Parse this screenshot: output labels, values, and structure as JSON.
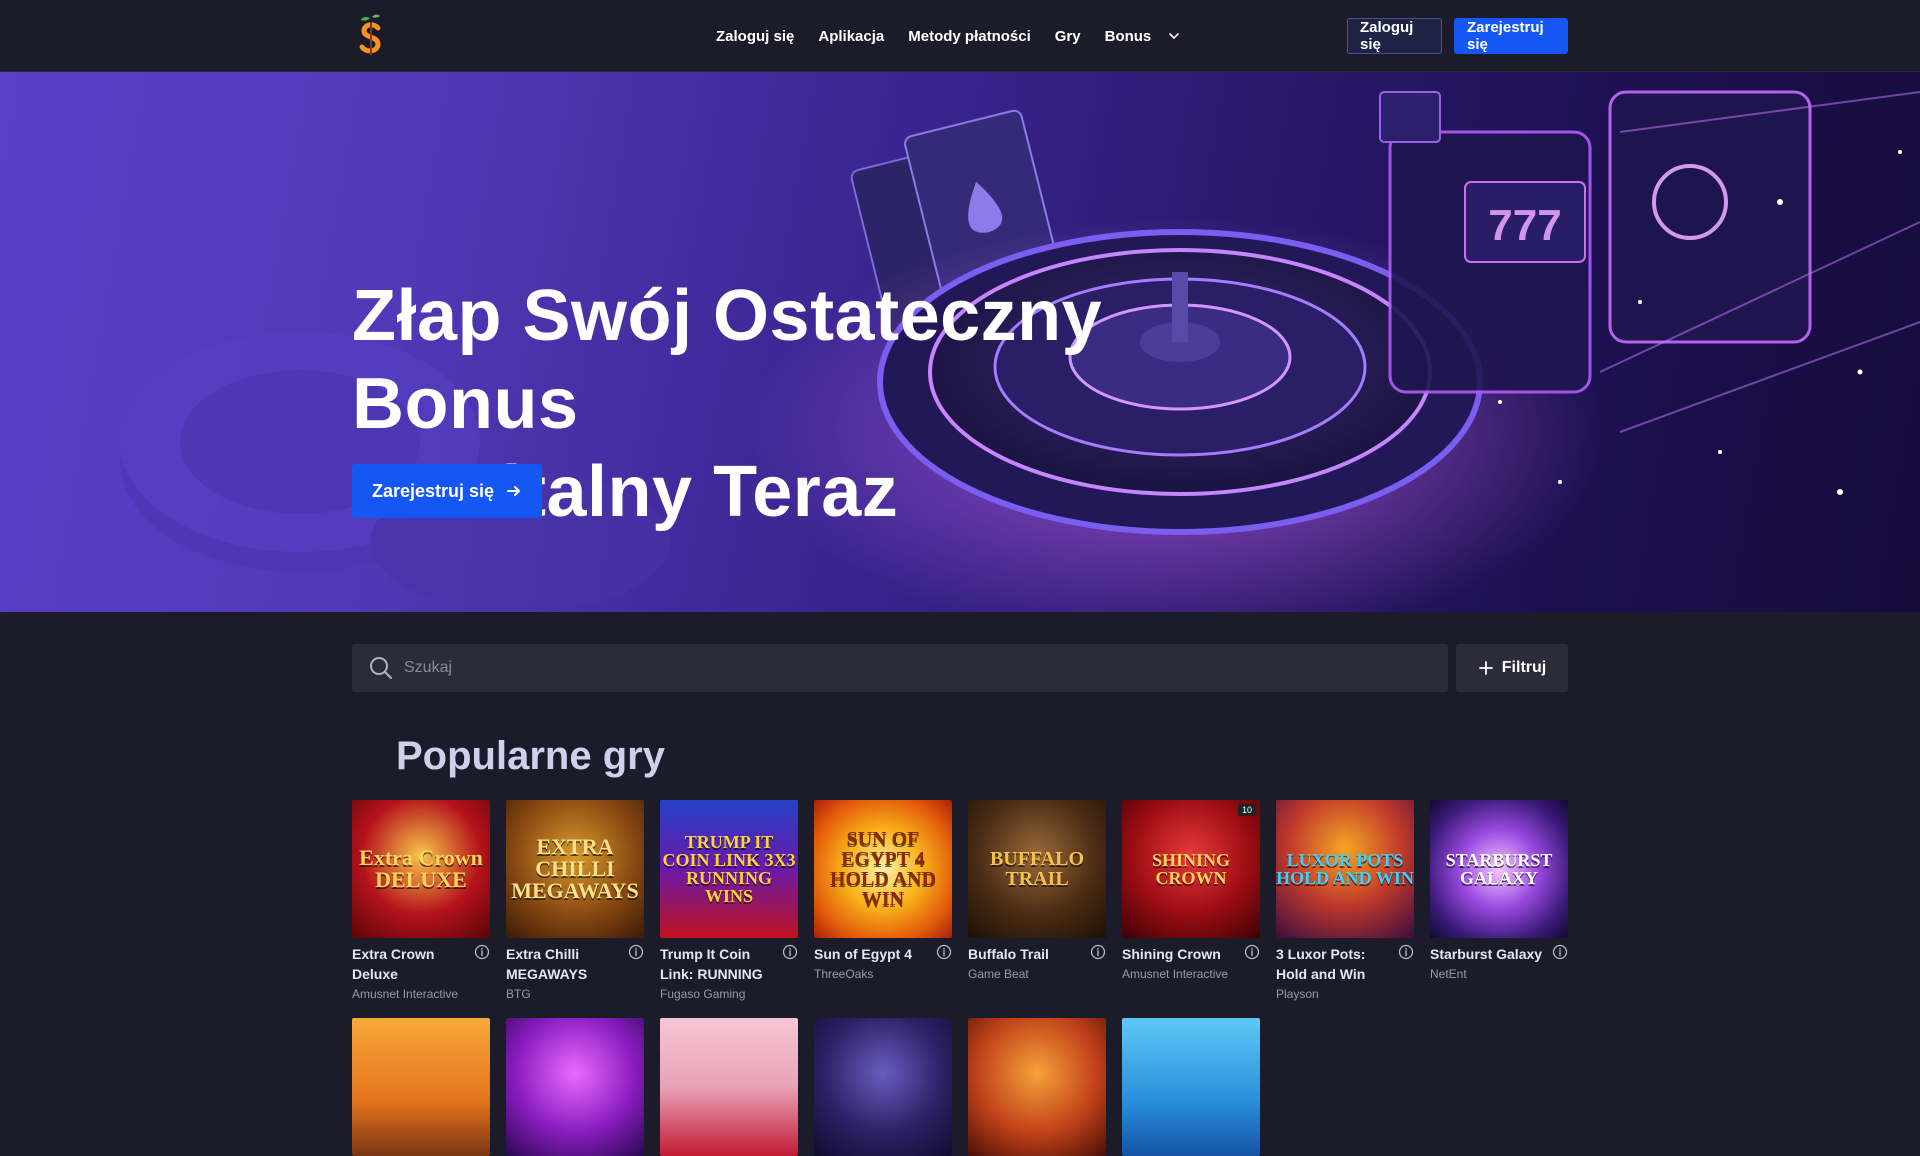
{
  "header": {
    "nav": [
      {
        "label": "Zaloguj się"
      },
      {
        "label": "Aplikacja"
      },
      {
        "label": "Metody płatności"
      },
      {
        "label": "Gry"
      },
      {
        "label": "Bonus"
      }
    ],
    "login_label": "Zaloguj się",
    "register_label": "Zarejestruj się"
  },
  "hero": {
    "title_line1": "Złap Swój Ostateczny Bonus",
    "title_line2": "Powitalny Teraz",
    "cta_label": "Zarejestruj się"
  },
  "search": {
    "placeholder": "Szukaj",
    "filter_label": "Filtruj"
  },
  "popular": {
    "title": "Popularne gry",
    "games": [
      {
        "name": "Extra Crown Deluxe",
        "provider": "Amusnet Interactive",
        "art": "Extra Crown DELUXE"
      },
      {
        "name": "Extra Chilli MEGAWAYS",
        "provider": "BTG",
        "art": "EXTRA CHILLI MEGAWAYS"
      },
      {
        "name": "Trump It Coin Link: RUNNING",
        "provider": "Fugaso Gaming",
        "art": "TRUMP IT COIN LINK 3X3 RUNNING WINS"
      },
      {
        "name": "Sun of Egypt 4",
        "provider": "ThreeOaks",
        "art": "SUN OF EGYPT 4 HOLD AND WIN"
      },
      {
        "name": "Buffalo Trail",
        "provider": "Game Beat",
        "art": "BUFFALO TRAIL"
      },
      {
        "name": "Shining Crown",
        "provider": "Amusnet Interactive",
        "art": "SHINING CROWN",
        "badge": "10"
      },
      {
        "name": "3 Luxor Pots: Hold and Win",
        "provider": "Playson",
        "art": "LUXOR POTS HOLD AND WIN"
      },
      {
        "name": "Starburst Galaxy",
        "provider": "NetEnt",
        "art": "STARBURST GALAXY"
      }
    ]
  },
  "colors": {
    "background": "#1b1b2a",
    "accent_blue": "#1457f5",
    "section_title": "#cfd0ec"
  },
  "icons": {
    "logo": "pear-s-logo-icon",
    "search": "search-icon",
    "filter": "plus-icon",
    "cta_arrow": "arrow-right-icon",
    "nav_chevron": "chevron-down-icon",
    "info": "info-icon"
  }
}
